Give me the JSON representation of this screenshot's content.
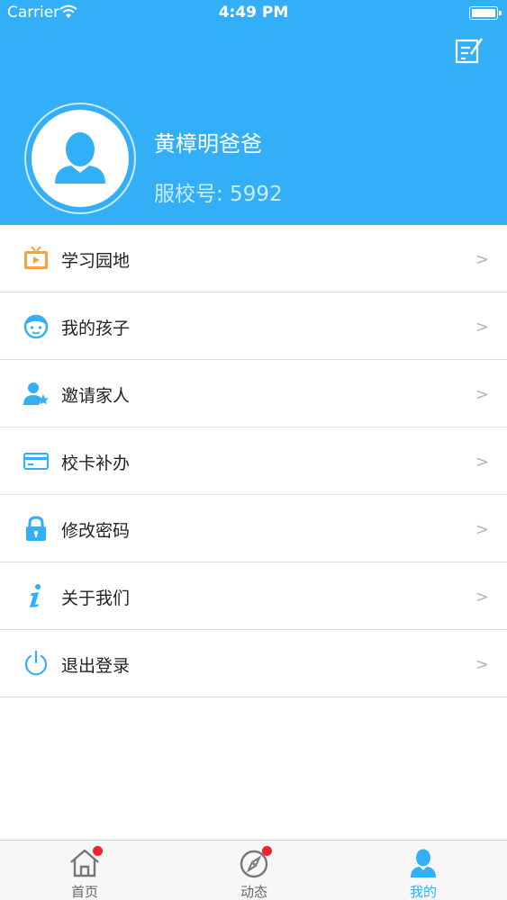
{
  "status_bar": {
    "carrier": "Carrier",
    "time": "4:49 PM"
  },
  "profile": {
    "name": "黄樟明爸爸",
    "school_no": "服校号: 5992"
  },
  "menu": [
    {
      "label": "学习园地",
      "icon": "tv-icon"
    },
    {
      "label": "我的孩子",
      "icon": "child-face-icon"
    },
    {
      "label": "邀请家人",
      "icon": "invite-user-icon"
    },
    {
      "label": "校卡补办",
      "icon": "card-icon"
    },
    {
      "label": "修改密码",
      "icon": "lock-icon"
    },
    {
      "label": "关于我们",
      "icon": "info-icon"
    },
    {
      "label": "退出登录",
      "icon": "power-icon"
    }
  ],
  "chevron": ">",
  "tabs": [
    {
      "label": "首页",
      "icon": "home-icon",
      "badge": true
    },
    {
      "label": "动态",
      "icon": "compass-icon",
      "badge": true
    },
    {
      "label": "我的",
      "icon": "user-icon",
      "active": true
    }
  ],
  "colors": {
    "primary": "#33aff8",
    "badge": "#f5222d",
    "tv_icon": "#f7a23b",
    "divider": "#dedede"
  }
}
